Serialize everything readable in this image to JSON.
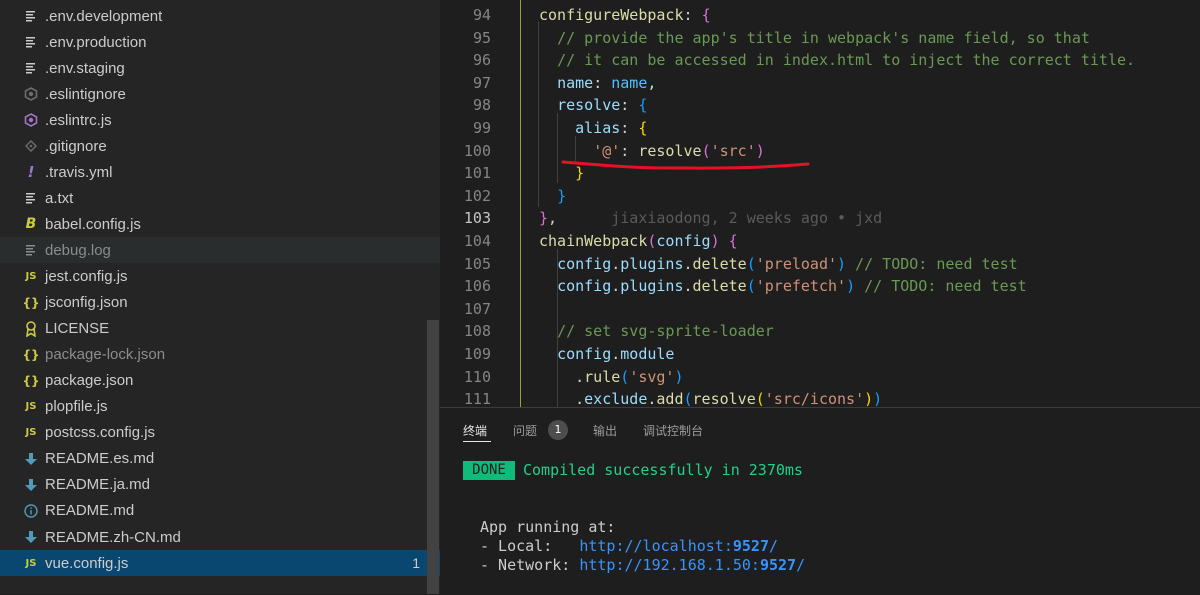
{
  "explorer": {
    "files": [
      {
        "name": ".env.development",
        "icon": "lines-icon",
        "color": "#cccccc"
      },
      {
        "name": ".env.production",
        "icon": "lines-icon",
        "color": "#cccccc"
      },
      {
        "name": ".env.staging",
        "icon": "lines-icon",
        "color": "#cccccc"
      },
      {
        "name": ".eslintignore",
        "icon": "eslint-dim-icon",
        "color": "#6d6d6d"
      },
      {
        "name": ".eslintrc.js",
        "icon": "eslint-icon",
        "color": "#a074c4"
      },
      {
        "name": ".gitignore",
        "icon": "git-icon",
        "color": "#6d6d6d"
      },
      {
        "name": ".travis.yml",
        "icon": "exclamation-icon",
        "color": "#a074c4"
      },
      {
        "name": "a.txt",
        "icon": "lines-icon",
        "color": "#cccccc"
      },
      {
        "name": "babel.config.js",
        "icon": "babel-icon",
        "color": "#cbcb41"
      },
      {
        "name": "debug.log",
        "icon": "lines-icon",
        "color": "#8c8c8c"
      },
      {
        "name": "jest.config.js",
        "icon": "js-icon",
        "color": "#cbcb41"
      },
      {
        "name": "jsconfig.json",
        "icon": "braces-icon",
        "color": "#cbcb41"
      },
      {
        "name": "LICENSE",
        "icon": "license-icon",
        "color": "#cbcb41"
      },
      {
        "name": "package-lock.json",
        "icon": "braces-icon",
        "color": "#cbcb41"
      },
      {
        "name": "package.json",
        "icon": "braces-icon",
        "color": "#cbcb41"
      },
      {
        "name": "plopfile.js",
        "icon": "js-icon",
        "color": "#cbcb41"
      },
      {
        "name": "postcss.config.js",
        "icon": "js-icon",
        "color": "#cbcb41"
      },
      {
        "name": "README.es.md",
        "icon": "markdown-icon",
        "color": "#519aba"
      },
      {
        "name": "README.ja.md",
        "icon": "markdown-icon",
        "color": "#519aba"
      },
      {
        "name": "README.md",
        "icon": "info-icon",
        "color": "#519aba"
      },
      {
        "name": "README.zh-CN.md",
        "icon": "markdown-icon",
        "color": "#519aba"
      },
      {
        "name": "vue.config.js",
        "icon": "js-icon",
        "color": "#cbcb41",
        "badge": "1"
      }
    ],
    "icon_glyphs": {
      "js": "JS",
      "braces": "{}",
      "exclamation": "!",
      "babel": "B",
      "info": "i"
    }
  },
  "editor": {
    "lines": [
      {
        "n": "94",
        "html": "<span class=\"k\">configureWebpack</span><span class=\"w\">: </span><span class=\"b2\">{</span>"
      },
      {
        "n": "95",
        "html": "  <span class=\"c\">// provide the app's title in webpack's name field, so that</span>"
      },
      {
        "n": "96",
        "html": "  <span class=\"c\">// it can be accessed in index.html to inject the correct title.</span>"
      },
      {
        "n": "97",
        "html": "  <span class=\"p\">name</span><span class=\"w\">: </span><span class=\"v\">name</span><span class=\"w\">,</span>"
      },
      {
        "n": "98",
        "html": "  <span class=\"p\">resolve</span><span class=\"w\">: </span><span class=\"b3\">{</span>"
      },
      {
        "n": "99",
        "html": "    <span class=\"p\">alias</span><span class=\"w\">: </span><span class=\"b1\">{</span>"
      },
      {
        "n": "100",
        "html": "      <span class=\"s\">'@'</span><span class=\"w\">: </span><span class=\"k\">resolve</span><span class=\"b2\">(</span><span class=\"s\">'src'</span><span class=\"b2\">)</span>"
      },
      {
        "n": "101",
        "html": "    <span class=\"b1\">}</span>"
      },
      {
        "n": "102",
        "html": "  <span class=\"b3\">}</span>"
      },
      {
        "n": "103",
        "html": "<span class=\"b2\">}</span><span class=\"w\">,</span>      <span class=\"blame\">jiaxiaodong, 2 weeks ago • jxd</span>",
        "current": true
      },
      {
        "n": "104",
        "html": "<span class=\"k\">chainWebpack</span><span class=\"b2\">(</span><span class=\"p\">config</span><span class=\"b2\">)</span><span class=\"w\"> </span><span class=\"b2\">{</span>"
      },
      {
        "n": "105",
        "html": "  <span class=\"p\">config</span><span class=\"w\">.</span><span class=\"p\">plugins</span><span class=\"w\">.</span><span class=\"k\">delete</span><span class=\"b3\">(</span><span class=\"s\">'preload'</span><span class=\"b3\">)</span><span class=\"w\"> </span><span class=\"c\">// TODO: need test</span>"
      },
      {
        "n": "106",
        "html": "  <span class=\"p\">config</span><span class=\"w\">.</span><span class=\"p\">plugins</span><span class=\"w\">.</span><span class=\"k\">delete</span><span class=\"b3\">(</span><span class=\"s\">'prefetch'</span><span class=\"b3\">)</span><span class=\"w\"> </span><span class=\"c\">// TODO: need test</span>"
      },
      {
        "n": "107",
        "html": ""
      },
      {
        "n": "108",
        "html": "  <span class=\"c\">// set svg-sprite-loader</span>"
      },
      {
        "n": "109",
        "html": "  <span class=\"p\">config</span><span class=\"w\">.</span><span class=\"p\">module</span>"
      },
      {
        "n": "110",
        "html": "    <span class=\"w\">.</span><span class=\"k\">rule</span><span class=\"b3\">(</span><span class=\"s\">'svg'</span><span class=\"b3\">)</span>"
      },
      {
        "n": "111",
        "html": "    <span class=\"w\">.</span><span class=\"p\">exclude</span><span class=\"w\">.</span><span class=\"k\">add</span><span class=\"b3\">(</span><span class=\"k\">resolve</span><span class=\"b1\">(</span><span class=\"s\">'src/icons'</span><span class=\"b1\">)</span><span class=\"b3\">)</span>"
      }
    ]
  },
  "panel": {
    "tabs": {
      "terminal": "终端",
      "problems": "问题",
      "output": "输出",
      "debug_console": "调试控制台"
    },
    "problem_count": "1",
    "done_label": "DONE",
    "compiled_message": "Compiled successfully in 2370ms",
    "app_running": "App running at:",
    "local_label": "- Local:   ",
    "local_url_prefix": "http://localhost:",
    "local_port": "9527",
    "local_url_suffix": "/",
    "network_label": "- Network: ",
    "network_url_prefix": "http://192.168.1.50:",
    "network_port": "9527",
    "network_url_suffix": "/"
  },
  "colors": {
    "accent_green": "#23d18b",
    "link_blue": "#3794ff",
    "annotation_red": "#e81123"
  }
}
